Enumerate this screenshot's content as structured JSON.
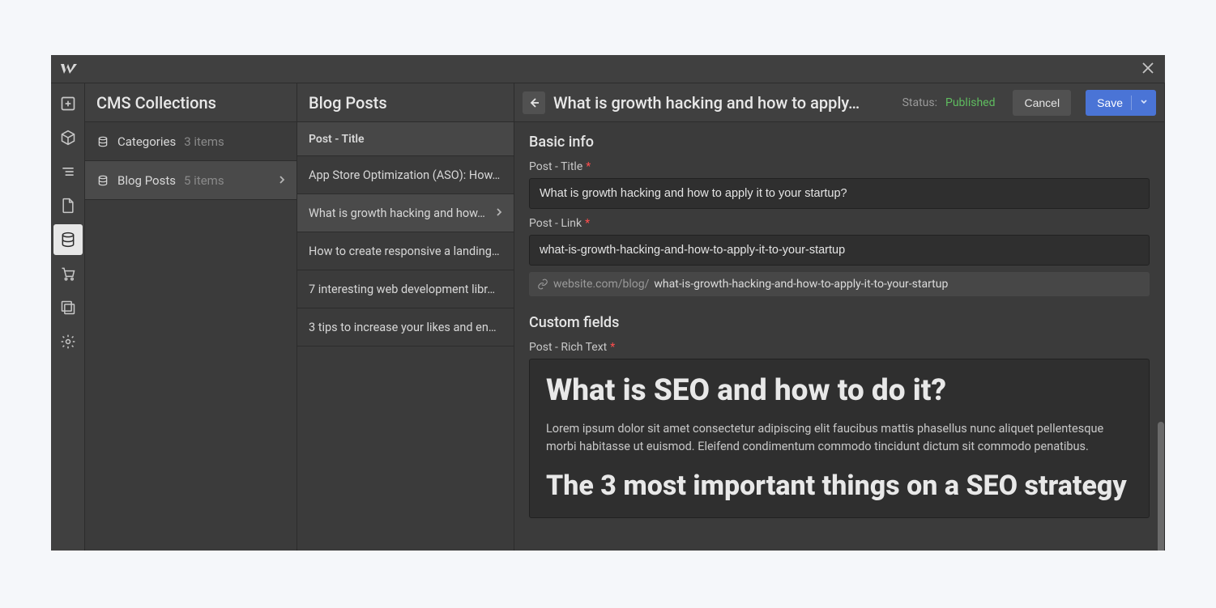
{
  "leftRail": {
    "items": [
      {
        "name": "add-icon"
      },
      {
        "name": "box-icon"
      },
      {
        "name": "navigator-icon"
      },
      {
        "name": "page-icon"
      },
      {
        "name": "database-icon",
        "active": true
      },
      {
        "name": "cart-icon"
      },
      {
        "name": "assets-icon"
      },
      {
        "name": "settings-icon"
      }
    ]
  },
  "collections": {
    "title": "CMS Collections",
    "items": [
      {
        "name": "Categories",
        "count": "3 items",
        "selected": false
      },
      {
        "name": "Blog Posts",
        "count": "5 items",
        "selected": true
      }
    ]
  },
  "itemsPanel": {
    "title": "Blog Posts",
    "columnHeader": "Post - Title",
    "items": [
      {
        "title": "App Store Optimization (ASO): How…",
        "selected": false
      },
      {
        "title": "What is growth hacking and how…",
        "selected": true
      },
      {
        "title": "How to create responsive a landing…",
        "selected": false
      },
      {
        "title": "7 interesting web development libr…",
        "selected": false
      },
      {
        "title": "3 tips to increase your likes and en…",
        "selected": false
      }
    ]
  },
  "editor": {
    "header": {
      "title": "What is growth hacking and how to apply…",
      "statusLabel": "Status:",
      "statusValue": "Published",
      "cancel": "Cancel",
      "save": "Save"
    },
    "basicInfo": {
      "sectionTitle": "Basic info",
      "titleLabel": "Post - Title",
      "titleValue": "What is growth hacking and how to apply it to your startup?",
      "linkLabel": "Post - Link",
      "linkValue": "what-is-growth-hacking-and-how-to-apply-it-to-your-startup",
      "urlPrefix": "website.com/blog/",
      "urlSlug": "what-is-growth-hacking-and-how-to-apply-it-to-your-startup"
    },
    "customFields": {
      "sectionTitle": "Custom fields",
      "richLabel": "Post - Rich Text",
      "h1": "What is SEO and how to do it?",
      "p": "Lorem ipsum dolor sit amet consectetur adipiscing elit faucibus mattis phasellus nunc aliquet pellentesque morbi habitasse ut euismod. Eleifend condimentum commodo tincidunt dictum sit commodo penatibus.",
      "h2": "The 3 most important things on a SEO strategy"
    }
  }
}
